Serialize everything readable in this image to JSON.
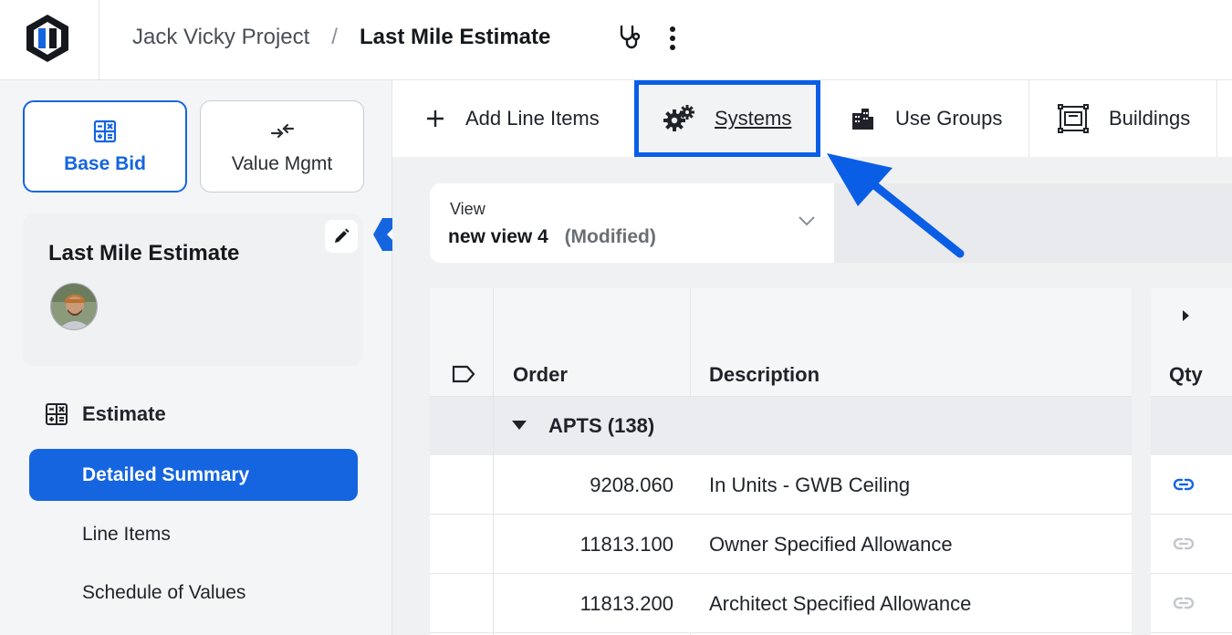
{
  "header": {
    "project": "Jack Vicky Project",
    "separator": "/",
    "current": "Last Mile Estimate"
  },
  "sidebar": {
    "base_bid": "Base Bid",
    "value_mgmt": "Value Mgmt",
    "estimate_card_title": "Last Mile Estimate",
    "section_title": "Estimate",
    "items": [
      {
        "label": "Detailed Summary",
        "active": true
      },
      {
        "label": "Line Items",
        "active": false
      },
      {
        "label": "Schedule of Values",
        "active": false
      }
    ]
  },
  "toolbar": {
    "add": "Add Line Items",
    "systems": "Systems",
    "use_groups": "Use Groups",
    "buildings": "Buildings"
  },
  "view": {
    "label": "View",
    "value": "new view 4",
    "modified": "(Modified)"
  },
  "grid": {
    "columns": [
      "Order",
      "Description",
      "Qty"
    ],
    "group": "APTS (138)",
    "rows": [
      {
        "order": "9208.060",
        "description": "In Units - GWB Ceiling",
        "linked": true
      },
      {
        "order": "11813.100",
        "description": "Owner Specified Allowance",
        "linked": false
      },
      {
        "order": "11813.200",
        "description": "Architect Specified Allowance",
        "linked": false
      }
    ]
  },
  "colors": {
    "accent": "#1565e0",
    "highlight": "#0a5ee6"
  }
}
